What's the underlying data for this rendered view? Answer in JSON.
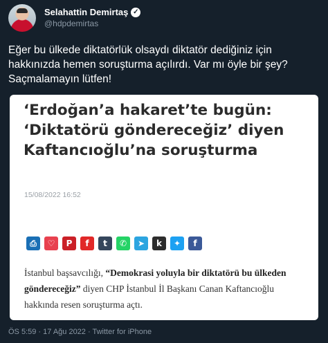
{
  "author": {
    "name": "Selahattin Demirtaş",
    "handle": "@hdpdemirtas",
    "verified_icon": "verified-badge"
  },
  "tweet": {
    "text": "Eğer bu ülkede diktatörlük olsaydı diktatör dediğiniz için hakkınızda hemen soruşturma açılırdı. Var mı öyle bir şey? Saçmalamayın lütfen!"
  },
  "card": {
    "headline": "‘Erdoğan’a hakaret’te bugün: ‘Diktatörü göndereceğiz’ diyen Kaftancıoğlu’na soruşturma",
    "date": "15/08/2022 16:52",
    "share_icons": [
      {
        "name": "print",
        "glyph": "⎙",
        "color": "#1a6fb5"
      },
      {
        "name": "pocket",
        "glyph": "♡",
        "color": "#e8414f"
      },
      {
        "name": "pinterest",
        "glyph": "P",
        "color": "#cb2027"
      },
      {
        "name": "flipboard",
        "glyph": "f",
        "color": "#e12828"
      },
      {
        "name": "tumblr",
        "glyph": "t",
        "color": "#35465c"
      },
      {
        "name": "whatsapp",
        "glyph": "✆",
        "color": "#25d366"
      },
      {
        "name": "telegram",
        "glyph": "➤",
        "color": "#2ca5e0"
      },
      {
        "name": "kik",
        "glyph": "k",
        "color": "#2d2d2d"
      },
      {
        "name": "twitter",
        "glyph": "✦",
        "color": "#1da1f2"
      },
      {
        "name": "facebook",
        "glyph": "f",
        "color": "#3b5998"
      }
    ],
    "excerpt_before": "İstanbul başsavcılığı, ",
    "excerpt_quote": "“Demokrasi yoluyla bir diktatörü bu ülkeden göndereceğiz”",
    "excerpt_after": " diyen CHP İstanbul İl Başkanı Canan Kaftancıoğlu hakkında resen soruşturma açtı."
  },
  "meta": "ÖS 5:59 · 17 Ağu 2022 · Twitter for iPhone"
}
